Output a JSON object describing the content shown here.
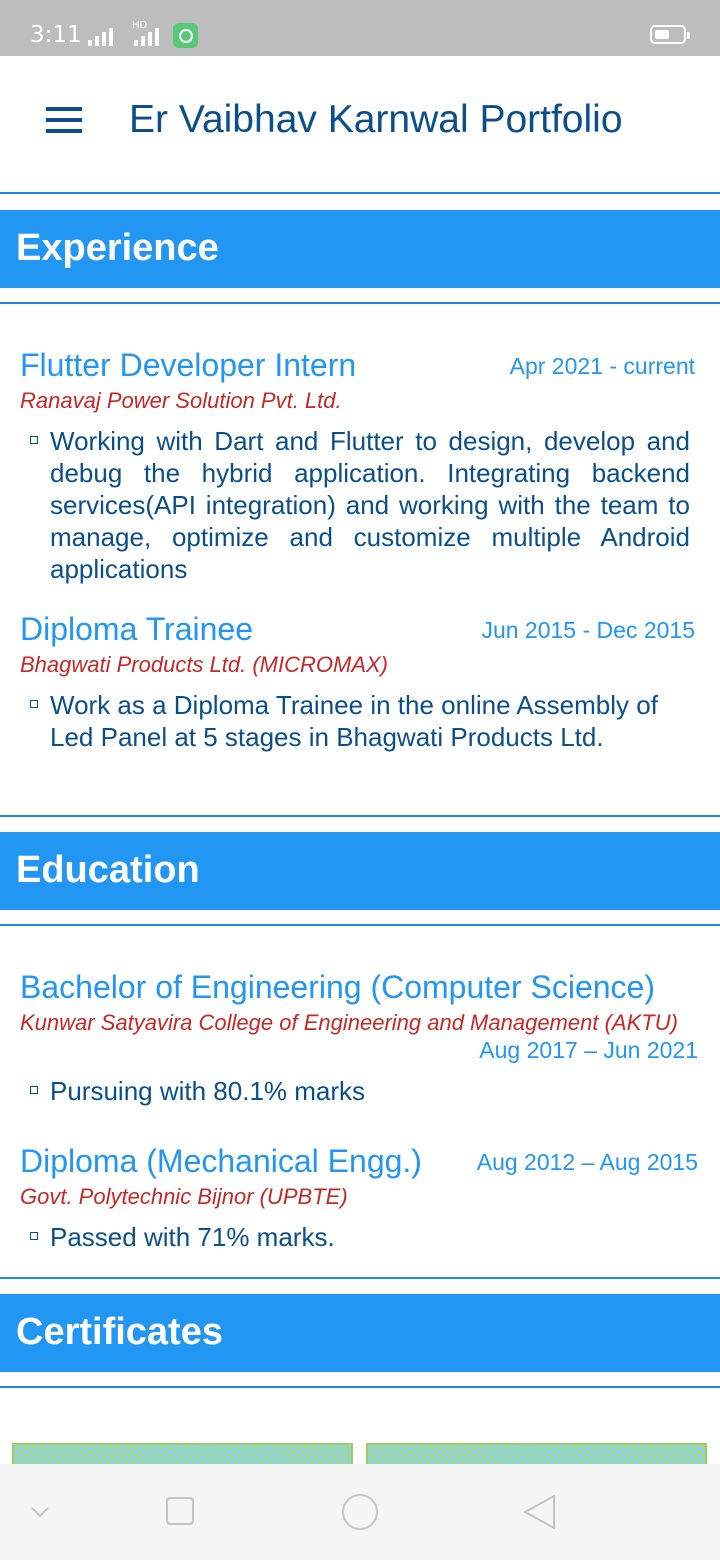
{
  "status_bar": {
    "time": "3:11",
    "hd_label": "HD",
    "icons": [
      "signal-icon",
      "hd-signal-icon",
      "app-notification-icon",
      "battery-icon"
    ]
  },
  "app_bar": {
    "title": "Er Vaibhav Karnwal Portfolio",
    "menu_icon": "hamburger-menu-icon"
  },
  "experience": {
    "heading": "Experience",
    "items": [
      {
        "title": "Flutter Developer Intern",
        "date": "Apr 2021 - current",
        "organization": "Ranavaj Power Solution Pvt. Ltd.",
        "points": [
          "Working with Dart and Flutter to design, develop and debug the hybrid application. Integrating backend services(API integration) and working with the team to manage, optimize and customize multiple Android applications"
        ]
      },
      {
        "title": "Diploma Trainee",
        "date": "Jun 2015 - Dec 2015",
        "organization": "Bhagwati Products Ltd. (MICROMAX)",
        "points": [
          "Work as a Diploma Trainee in the online Assembly of\nLed Panel at 5 stages in Bhagwati Products Ltd."
        ]
      }
    ]
  },
  "education": {
    "heading": "Education",
    "items": [
      {
        "title": "Bachelor of Engineering (Computer Science)",
        "organization": "Kunwar Satyavira College of Engineering and Management (AKTU)",
        "date": "Aug 2017 – Jun 2021",
        "points": [
          "Pursuing with 80.1% marks"
        ]
      },
      {
        "title": "Diploma (Mechanical Engg.)",
        "date": "Aug 2012 – Aug 2015",
        "organization": "Govt. Polytechnic Bijnor (UPBTE)",
        "points": [
          "Passed with 71% marks."
        ]
      }
    ]
  },
  "certificates": {
    "heading": "Certificates",
    "count_visible": 2
  },
  "nav_bar": {
    "buttons": [
      "collapse-icon",
      "recents-icon",
      "home-icon",
      "back-icon"
    ]
  },
  "colors": {
    "primary": "#2196f3",
    "title_text": "#0b4f8a",
    "organization_text": "#c62828",
    "status_bar": "#bdbdbd"
  }
}
